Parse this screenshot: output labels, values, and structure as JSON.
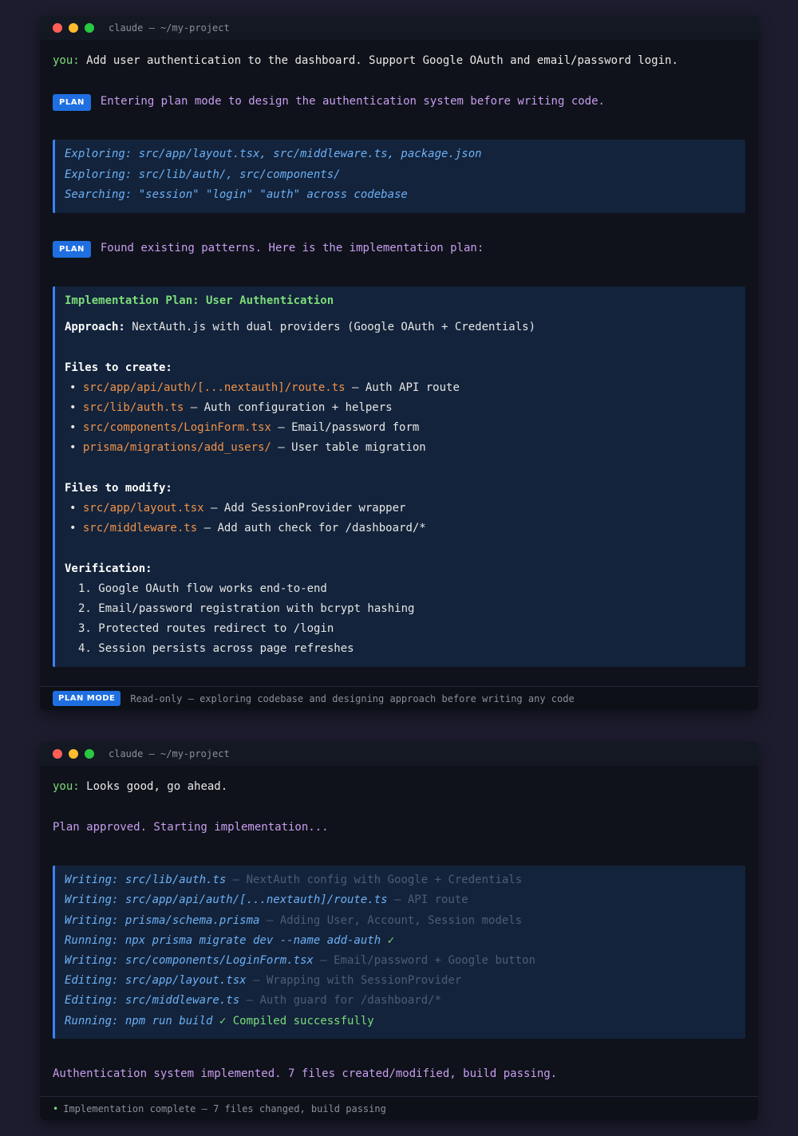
{
  "window1": {
    "title": "claude — ~/my-project",
    "user_label": "you:",
    "user_message": "Add user authentication to the dashboard. Support Google OAuth and email/password login.",
    "plan_badge": "PLAN",
    "plan_msg_1": "Entering plan mode to design the authentication system before writing code.",
    "exploring": [
      "Exploring: src/app/layout.tsx, src/middleware.ts, package.json",
      "Exploring: src/lib/auth/, src/components/",
      "Searching: \"session\" \"login\" \"auth\" across codebase"
    ],
    "plan_msg_2": "Found existing patterns. Here is the implementation plan:",
    "plan": {
      "title": "Implementation Plan: User Authentication",
      "approach_label": "Approach:",
      "approach_text": " NextAuth.js with dual providers (Google OAuth + Credentials)",
      "create_heading": "Files to create:",
      "create_items": [
        {
          "file": "src/app/api/auth/[...nextauth]/route.ts",
          "desc": " — Auth API route"
        },
        {
          "file": "src/lib/auth.ts",
          "desc": " — Auth configuration + helpers"
        },
        {
          "file": "src/components/LoginForm.tsx",
          "desc": " — Email/password form"
        },
        {
          "file": "prisma/migrations/add_users/",
          "desc": " — User table migration"
        }
      ],
      "modify_heading": "Files to modify:",
      "modify_items": [
        {
          "file": "src/app/layout.tsx",
          "desc": " — Add SessionProvider wrapper"
        },
        {
          "file": "src/middleware.ts",
          "desc": " — Add auth check for /dashboard/*"
        }
      ],
      "verify_heading": "Verification:",
      "verify_items": [
        "1. Google OAuth flow works end-to-end",
        "2. Email/password registration with bcrypt hashing",
        "3. Protected routes redirect to /login",
        "4. Session persists across page refreshes"
      ]
    },
    "status_badge": "PLAN MODE",
    "status_text": "Read-only — exploring codebase and designing approach before writing any code"
  },
  "window2": {
    "title": "claude — ~/my-project",
    "user_label": "you:",
    "user_message": "Looks good, go ahead.",
    "approved_msg": "Plan approved. Starting implementation...",
    "log": [
      {
        "action": "Writing: src/lib/auth.ts",
        "note": " — NextAuth config with Google + Credentials"
      },
      {
        "action": "Writing: src/app/api/auth/[...nextauth]/route.ts",
        "note": " — API route"
      },
      {
        "action": "Writing: prisma/schema.prisma",
        "note": " — Adding User, Account, Session models"
      },
      {
        "action": "Running: npx prisma migrate dev --name add-auth",
        "ok": " ✓"
      },
      {
        "action": "Writing: src/components/LoginForm.tsx",
        "note": " — Email/password + Google button"
      },
      {
        "action": "Editing: src/app/layout.tsx",
        "note": " — Wrapping with SessionProvider"
      },
      {
        "action": "Editing: src/middleware.ts",
        "note": " — Auth guard for /dashboard/*"
      },
      {
        "action": "Running: npm run build",
        "ok": " ✓ Compiled successfully"
      }
    ],
    "done_msg": "Authentication system implemented. 7 files created/modified, build passing.",
    "status_bullet": "•",
    "status_text": "Implementation complete — 7 files changed, build passing"
  }
}
